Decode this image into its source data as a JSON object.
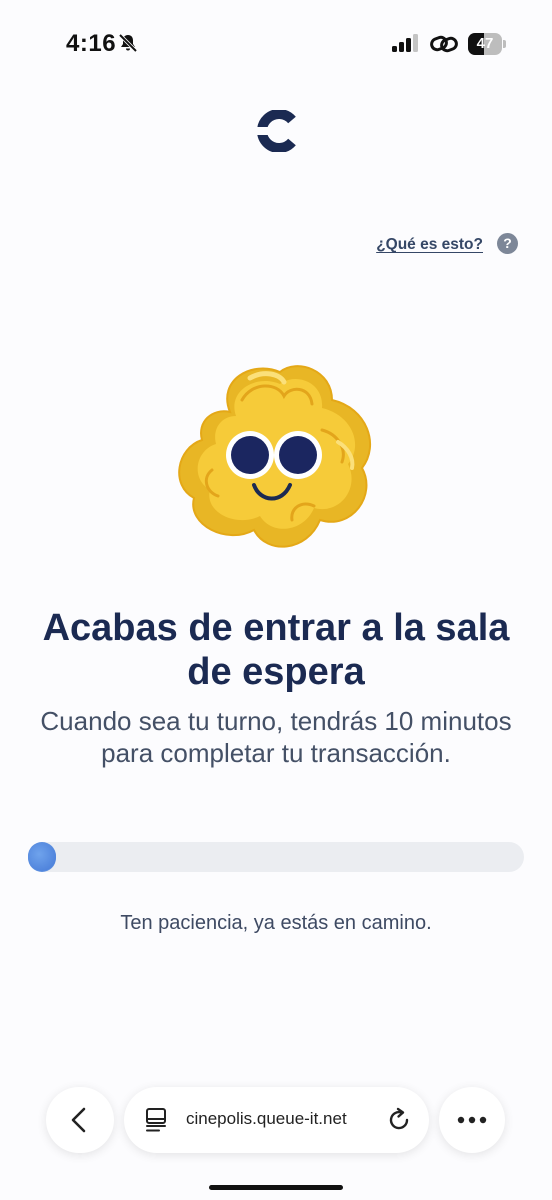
{
  "status_bar": {
    "time": "4:16",
    "battery_level": "47",
    "icons": [
      "bell-slash-icon",
      "signal-icon",
      "link-icon",
      "battery-icon"
    ]
  },
  "brand": {
    "logo_icon": "cinepolis-c-logo",
    "accent_color": "#1b2a52"
  },
  "help": {
    "link_label": "¿Qué es esto?",
    "icon_label": "?"
  },
  "main": {
    "mascot_icon": "popcorn-mascot",
    "headline": "Acabas de entrar a la sala de espera",
    "subtitle": "Cuando sea tu turno, tendrás 10 minutos para completar tu transacción.",
    "progress": 0.03,
    "progress_color": "#5c8fe0",
    "patience_text": "Ten paciencia, ya estás en camino."
  },
  "browser": {
    "url": "cinepolis.queue-it.net",
    "back_icon": "chevron-left-icon",
    "tabs_icon": "tabs-icon",
    "reload_icon": "reload-icon",
    "more_icon": "more-icon"
  }
}
